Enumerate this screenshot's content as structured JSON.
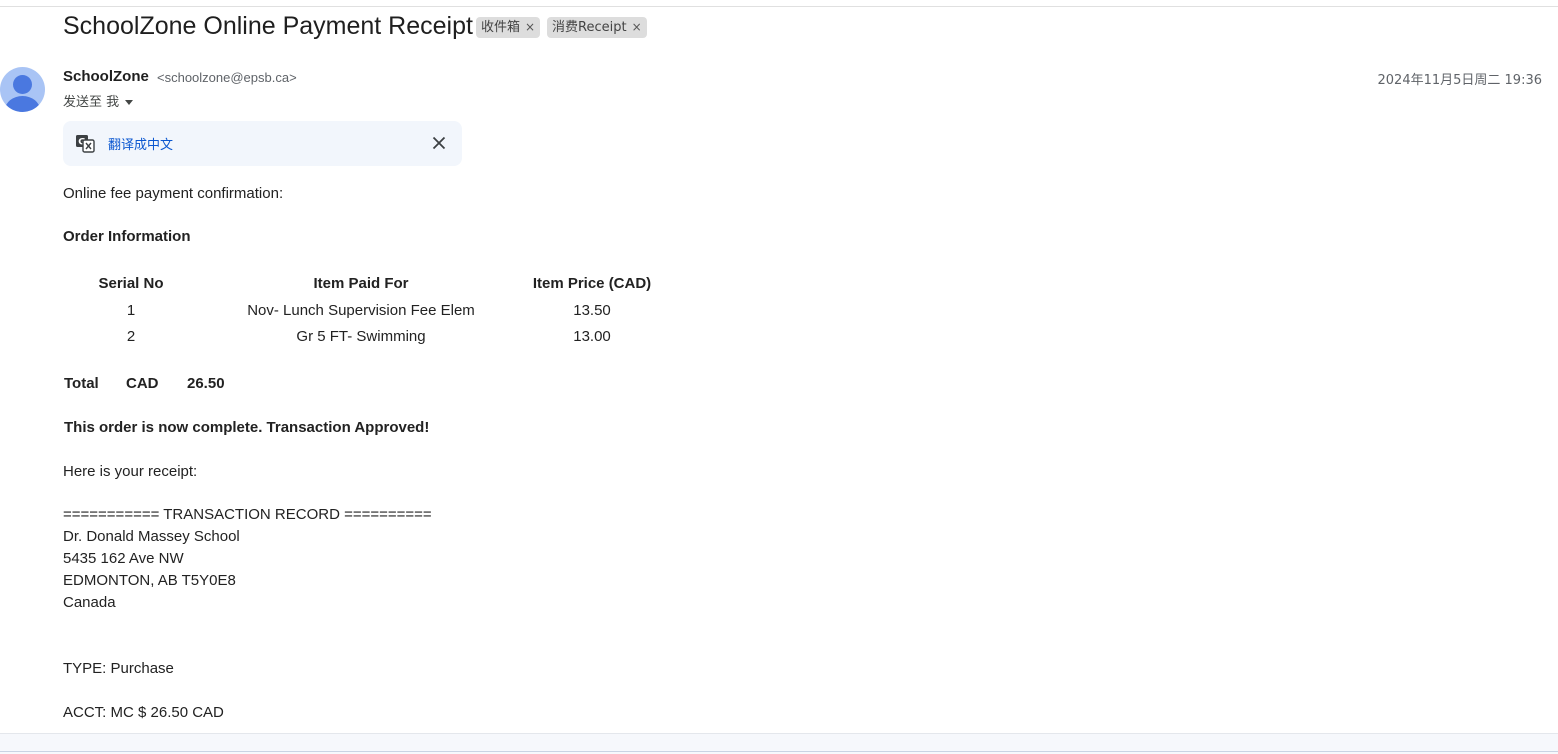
{
  "email": {
    "subject": "SchoolZone Online Payment Receipt",
    "labels": [
      {
        "name": "收件箱",
        "remove": "×"
      },
      {
        "name": "消费Receipt",
        "remove": "×"
      }
    ],
    "sender_name": "SchoolZone",
    "sender_email": "<schoolzone@epsb.ca>",
    "recipient": "发送至 我",
    "date": "2024年11月5日周二 19:36"
  },
  "translate": {
    "link": "翻译成中文",
    "icon": "translate-icon",
    "close_icon": "close-icon"
  },
  "body": {
    "intro": "Online fee payment confirmation:",
    "order_heading": "Order Information",
    "table": {
      "headers": [
        "Serial No",
        "Item Paid For",
        "Item Price (CAD)"
      ],
      "rows": [
        [
          "1",
          "Nov- Lunch Supervision Fee Elem",
          "13.50"
        ],
        [
          "2",
          "Gr 5 FT- Swimming",
          "13.00"
        ]
      ]
    },
    "total": {
      "label": "Total",
      "currency": "CAD",
      "amount": "26.50"
    },
    "status": "This order is now complete. Transaction Approved!",
    "receipt_intro": "Here is your receipt:",
    "record_header": "=========== TRANSACTION RECORD ==========",
    "school": "Dr. Donald Massey School",
    "address1": "5435 162 Ave NW",
    "address2": "EDMONTON, AB T5Y0E8",
    "country": "Canada",
    "type": "TYPE: Purchase",
    "acct": "ACCT: MC $ 26.50 CAD"
  }
}
